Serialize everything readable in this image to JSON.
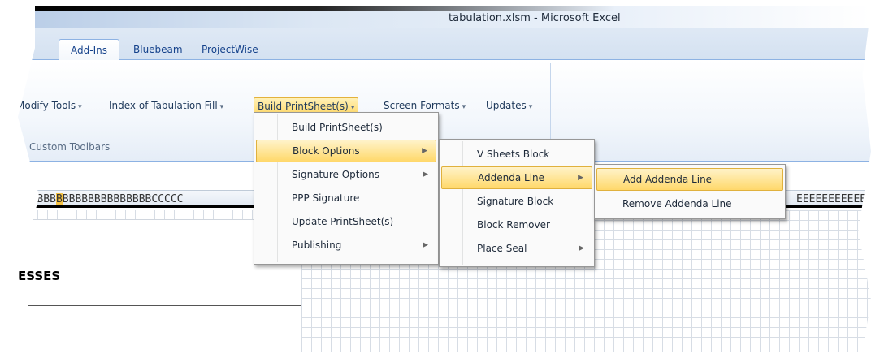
{
  "window": {
    "title": "tabulation.xlsm  -  Microsoft Excel"
  },
  "tabs": [
    {
      "label": "Add-Ins",
      "active": true
    },
    {
      "label": "Bluebeam",
      "active": false
    },
    {
      "label": "ProjectWise",
      "active": false
    }
  ],
  "toolbar": {
    "items": [
      {
        "label": "Modify Tools",
        "active": false
      },
      {
        "label": "Index of Tabulation Fill",
        "active": false
      },
      {
        "label": "Build  PrintSheet(s)",
        "active": true
      },
      {
        "label": "Screen Formats",
        "active": false
      },
      {
        "label": "Updates",
        "active": false
      }
    ],
    "dropdown_glyph": "▾",
    "group_label": "Custom Toolbars"
  },
  "sheet": {
    "column_letters_left": "BBBBBB",
    "column_letters_highlight": "B",
    "column_letters_rest": "BBBBBBBBBBBBBBCCCCC",
    "column_letters_right": "EEEEEEEEEEEE",
    "addresses_label": "ESSES"
  },
  "menus": {
    "submenu_glyph": "▶",
    "level1": [
      {
        "label": "Build  PrintSheet(s)",
        "submenu": false,
        "highlighted": false
      },
      {
        "label": "Block Options",
        "submenu": true,
        "highlighted": true
      },
      {
        "label": "Signature Options",
        "submenu": true,
        "highlighted": false
      },
      {
        "label": "PPP Signature",
        "submenu": false,
        "highlighted": false
      },
      {
        "label": "Update  PrintSheet(s)",
        "submenu": false,
        "highlighted": false
      },
      {
        "label": "Publishing",
        "submenu": true,
        "highlighted": false
      }
    ],
    "level2": [
      {
        "label": "V Sheets Block",
        "submenu": false,
        "highlighted": false
      },
      {
        "label": "Addenda Line",
        "submenu": true,
        "highlighted": true
      },
      {
        "label": "Signature Block",
        "submenu": false,
        "highlighted": false
      },
      {
        "label": "Block Remover",
        "submenu": false,
        "highlighted": false
      },
      {
        "label": "Place Seal",
        "submenu": true,
        "highlighted": false
      }
    ],
    "level3": [
      {
        "label": "Add Addenda Line",
        "submenu": false,
        "highlighted": true
      },
      {
        "label": "Remove Addenda Line",
        "submenu": false,
        "highlighted": false
      }
    ]
  }
}
